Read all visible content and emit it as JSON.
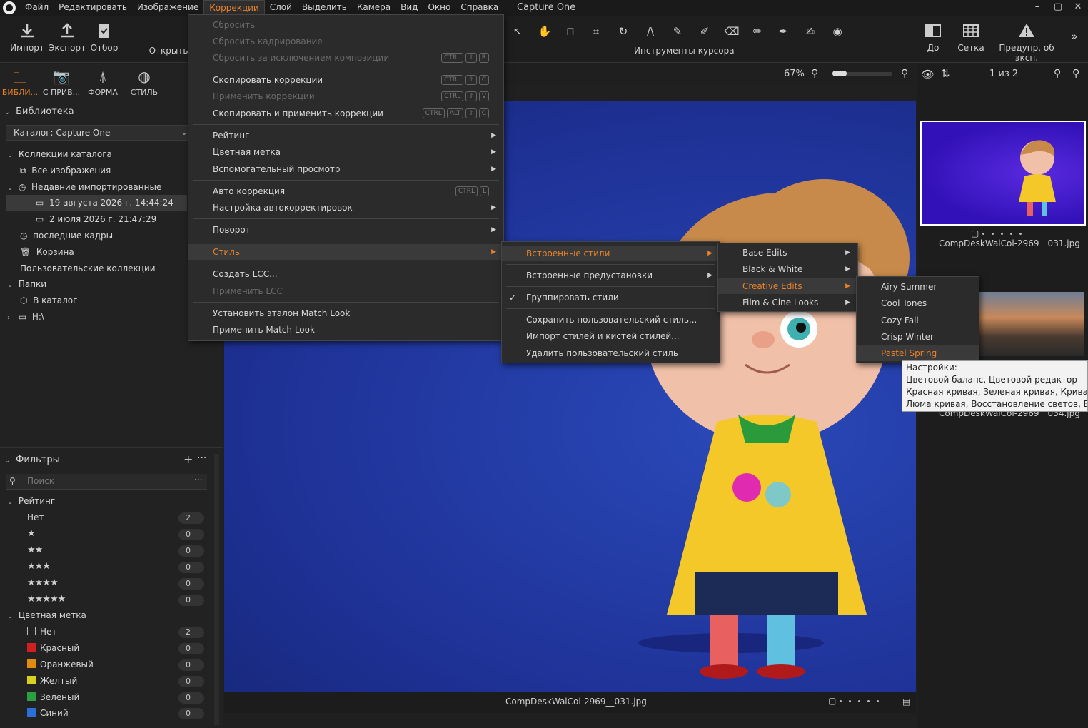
{
  "app": {
    "title": "Capture One"
  },
  "menubar": [
    "Файл",
    "Редактировать",
    "Изображение",
    "Коррекции",
    "Слой",
    "Выделить",
    "Камера",
    "Вид",
    "Окно",
    "Справка"
  ],
  "toolbar": {
    "import": "Импорт",
    "export": "Экспорт",
    "cull": "Отбор",
    "open": "Открыть",
    "cursor_tools": "Инструменты курсора",
    "before": "До",
    "grid": "Сетка",
    "exposure_warning": "Предупр. об эксп."
  },
  "viewer": {
    "zoom": "67%",
    "counter": "1 из 2",
    "filename": "CompDeskWalCol-2969__031.jpg",
    "meta": [
      "--",
      "--",
      "--",
      "--"
    ]
  },
  "tabs": [
    "БИБЛИ...",
    "С ПРИВ...",
    "ФОРМА",
    "СТИЛЬ"
  ],
  "library": {
    "title": "Библиотека",
    "catalog": "Каталог: Capture One",
    "catalog_collections": "Коллекции каталога",
    "all_images": "Все изображения",
    "recent_imports": "Недавние импортированные",
    "import1": "19 августа 2026 г. 14:44:24",
    "import2": "2 июля 2026 г. 21:47:29",
    "recent_captures": "последние кадры",
    "trash": "Корзина",
    "user_collections": "Пользовательские коллекции",
    "folders": "Папки",
    "in_catalog": "В каталог",
    "drive": "H:\\"
  },
  "filters": {
    "title": "Фильтры",
    "search_placeholder": "Поиск",
    "rating_title": "Рейтинг",
    "rating_none": "Нет",
    "rating_counts": [
      "2",
      "0",
      "0",
      "0",
      "0",
      "0"
    ],
    "color_title": "Цветная метка",
    "colors": [
      {
        "label": "Нет",
        "count": "2",
        "color": ""
      },
      {
        "label": "Красный",
        "count": "0",
        "color": "#d02020"
      },
      {
        "label": "Оранжевый",
        "count": "0",
        "color": "#e08a10"
      },
      {
        "label": "Желтый",
        "count": "0",
        "color": "#d8d020"
      },
      {
        "label": "Зеленый",
        "count": "0",
        "color": "#2aa040"
      },
      {
        "label": "Синий",
        "count": "0",
        "color": "#2a70d8"
      }
    ]
  },
  "adjustments_menu": {
    "reset": "Сбросить",
    "reset_crop": "Сбросить кадрирование",
    "reset_except": "Сбросить за исключением композиции",
    "copy": "Скопировать коррекции",
    "apply": "Применить коррекции",
    "copy_apply": "Скопировать и применить коррекции",
    "rating": "Рейтинг",
    "color_tag": "Цветная метка",
    "proof": "Вспомогательный просмотр",
    "auto": "Авто коррекция",
    "auto_settings": "Настройка автокорректировок",
    "rotate": "Поворот",
    "style": "Стиль",
    "create_lcc": "Создать LCC...",
    "apply_lcc": "Применить LCC",
    "set_match": "Установить эталон Match Look",
    "apply_match": "Применить Match Look",
    "keys": {
      "reset_except": [
        "CTRL",
        "⇧",
        "R"
      ],
      "copy": [
        "CTRL",
        "⇧",
        "C"
      ],
      "apply": [
        "CTRL",
        "⇧",
        "V"
      ],
      "copy_apply": [
        "CTRL",
        "ALT",
        "⇧",
        "C"
      ],
      "auto": [
        "CTRL",
        "L"
      ]
    }
  },
  "style_menu": {
    "builtin": "Встроенные стили",
    "presets": "Встроенные предустановки",
    "group": "Группировать стили",
    "save": "Сохранить пользовательский стиль...",
    "import": "Импорт стилей и кистей стилей...",
    "delete": "Удалить пользовательский стиль"
  },
  "builtin_menu": [
    "Base Edits",
    "Black & White",
    "Creative Edits",
    "Film & Cine Looks"
  ],
  "creative_menu": [
    "Airy Summer",
    "Cool Tones",
    "Cozy Fall",
    "Crisp Winter",
    "Pastel Spring"
  ],
  "tooltip": {
    "line1": "Настройки:",
    "line2": "Цветовой баланс, Цветовой редактор - Расш",
    "line3": "Красная кривая, Зеленая кривая, Кривая син",
    "line4": "Люма кривая, Восстановление светов, Восста"
  },
  "browser": {
    "thumb1": "CompDeskWalCol-2969__031.jpg",
    "thumb2": "CompDeskWalCol-2969__034.jpg"
  }
}
